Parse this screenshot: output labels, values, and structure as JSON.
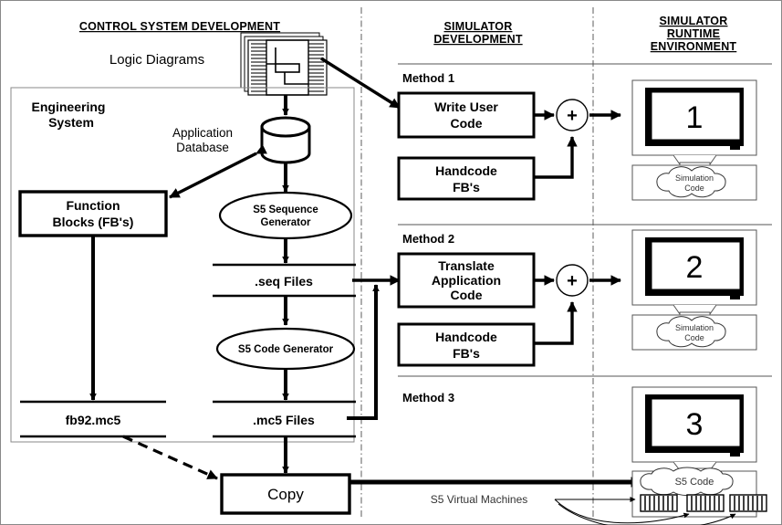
{
  "diagram": {
    "title": "Control System Development / Simulator Development / Simulator Runtime Environment flow",
    "columns": {
      "left_header": "CONTROL SYSTEM DEVELOPMENT",
      "mid_header_line1": "SIMULATOR",
      "mid_header_line2": "DEVELOPMENT",
      "right_header_line1": "SIMULATOR",
      "right_header_line2": "RUNTIME",
      "right_header_line3": "ENVIRONMENT"
    },
    "left": {
      "logic_diagrams_label": "Logic Diagrams",
      "engineering_system_line1": "Engineering",
      "engineering_system_line2": "System",
      "application_database_line1": "Application",
      "application_database_line2": "Database",
      "function_blocks_line1": "Function",
      "function_blocks_line2": "Blocks (FB's)",
      "s5_sequence_generator_line1": "S5 Sequence",
      "s5_sequence_generator_line2": "Generator",
      "seq_files": ".seq Files",
      "s5_code_generator": "S5 Code Generator",
      "fb92": "fb92.mc5",
      "mc5_files": ".mc5 Files",
      "copy": "Copy"
    },
    "methods": [
      {
        "label": "Method 1",
        "primary_line1": "Write User",
        "primary_line2": "Code",
        "secondary_line1": "Handcode",
        "secondary_line2": "FB's",
        "adder": "+",
        "monitor_number": "1",
        "base_cloud_line1": "Simulation",
        "base_cloud_line2": "Code"
      },
      {
        "label": "Method 2",
        "primary_line1": "Translate",
        "primary_line2": "Application",
        "primary_line3": "Code",
        "secondary_line1": "Handcode",
        "secondary_line2": "FB's",
        "adder": "+",
        "monitor_number": "2",
        "base_cloud_line1": "Simulation",
        "base_cloud_line2": "Code"
      },
      {
        "label": "Method 3",
        "monitor_number": "3",
        "base_cloud_line1": "S5 Code",
        "virtual_machines_label": "S5 Virtual Machines",
        "vm_count": 3
      }
    ],
    "colors": {
      "stroke": "#000000",
      "separator": "#888888",
      "background": "#ffffff",
      "muted_text": "#333333"
    }
  }
}
